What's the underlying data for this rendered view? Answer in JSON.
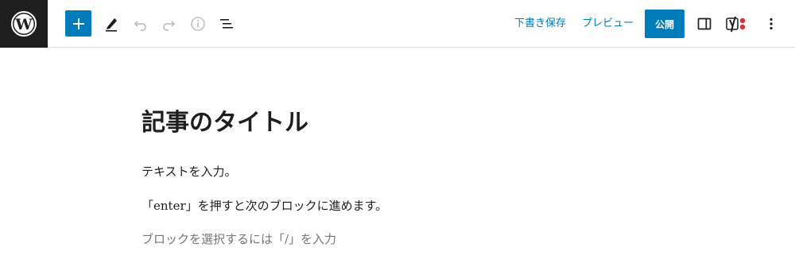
{
  "toolbar": {
    "logo": "wordpress-logo-icon",
    "add_block": "plus-icon",
    "tools": "pencil-icon",
    "undo": "undo-icon",
    "redo": "redo-icon",
    "details": "info-icon",
    "list_view": "list-view-icon",
    "save_draft_label": "下書き保存",
    "preview_label": "プレビュー",
    "publish_label": "公開",
    "settings": "sidebar-toggle-icon",
    "yoast": "yoast-icon",
    "options": "more-vertical-icon"
  },
  "colors": {
    "accent": "#007cba",
    "logo_bg": "#1e1e1e",
    "yoast_dot": "#dc3232",
    "placeholder": "#757575",
    "disabled_icon": "#c0c0c0"
  },
  "editor": {
    "title": "記事のタイトル",
    "paragraphs": [
      "テキストを入力。",
      "「enter」を押すと次のブロックに進めます。"
    ],
    "placeholder": "ブロックを選択するには「/」を入力"
  }
}
